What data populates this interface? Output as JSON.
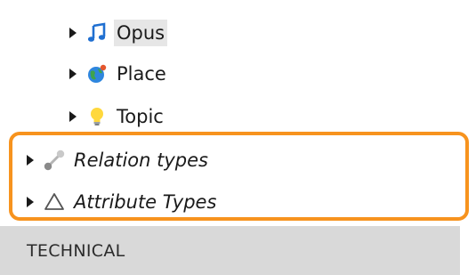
{
  "tree": {
    "items": [
      {
        "label": "Opus",
        "icon": "music-note-icon",
        "selected": true
      },
      {
        "label": "Place",
        "icon": "globe-icon",
        "selected": false
      },
      {
        "label": "Topic",
        "icon": "lightbulb-icon",
        "selected": false
      },
      {
        "label": "Relation types",
        "icon": "relation-icon",
        "italic": true
      },
      {
        "label": "Attribute Types",
        "icon": "triangle-icon",
        "italic": true
      }
    ]
  },
  "section": {
    "label": "TECHNICAL"
  },
  "colors": {
    "highlight": "#f7931e",
    "selection": "#e6e6e6",
    "section_bg": "#d9d9d9"
  }
}
